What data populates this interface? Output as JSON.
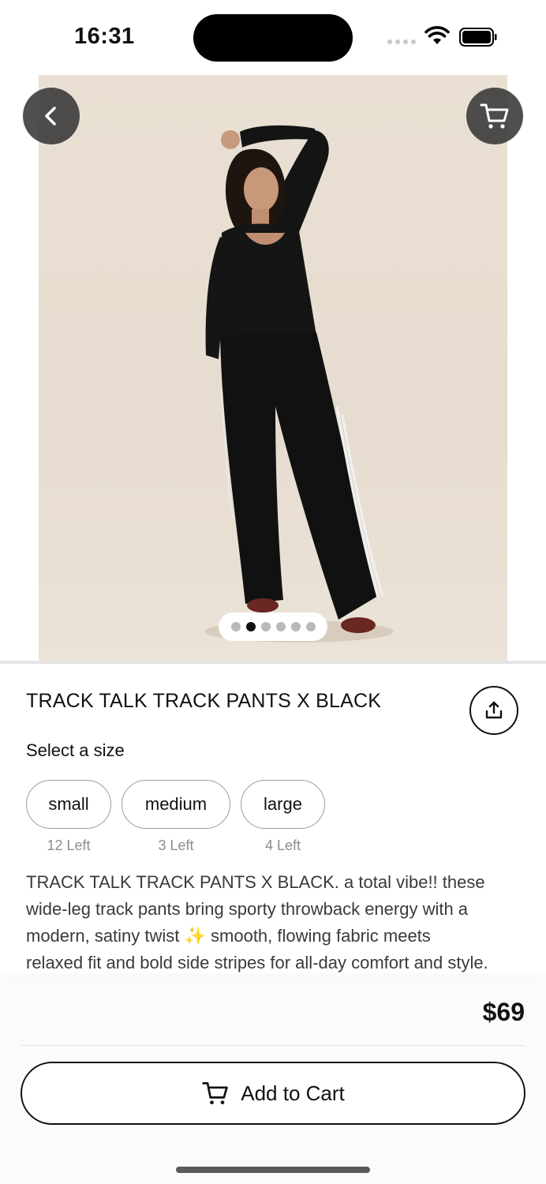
{
  "status_bar": {
    "time": "16:31"
  },
  "product": {
    "title": "TRACK TALK TRACK PANTS X BLACK",
    "image_count": 6,
    "active_image_index": 1,
    "select_size_label": "Select a size",
    "sizes": [
      {
        "label": "small",
        "stock": "12 Left"
      },
      {
        "label": "medium",
        "stock": "3 Left"
      },
      {
        "label": "large",
        "stock": "4 Left"
      }
    ],
    "description_lines": [
      "TRACK TALK TRACK PANTS X BLACK. a total vibe!! these",
      "wide-leg track pants bring sporty throwback energy with a",
      "modern, satiny twist ✨ smooth, flowing fabric meets",
      "relaxed fit and bold side stripes for all-day comfort and style."
    ]
  },
  "footer": {
    "price": "$69",
    "add_to_cart_label": "Add to Cart"
  },
  "icons": {
    "back": "chevron-left-icon",
    "cart": "cart-icon",
    "share": "share-icon"
  },
  "colors": {
    "overlay_button": "#373737",
    "hero_background": "#e8dfd2",
    "text_primary": "#111111",
    "text_muted": "#8d8d8d"
  }
}
